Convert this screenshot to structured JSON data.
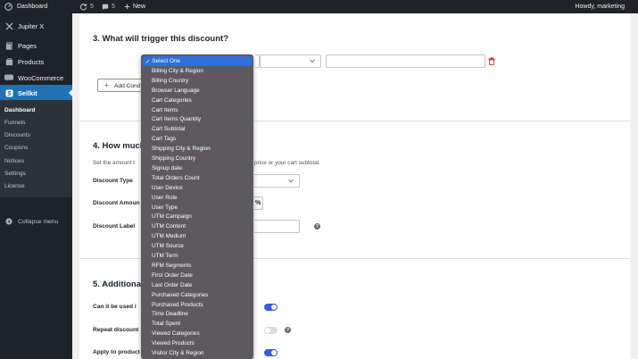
{
  "admin_bar": {
    "dashboard_label": "Dashboard",
    "updates_count": "5",
    "comments_count": "5",
    "new_label": "New",
    "howdy": "Howdy, marketing"
  },
  "sidebar": {
    "items": [
      {
        "label": "Jupiter X",
        "icon": "jupiterx-icon"
      },
      {
        "label": "Pages",
        "icon": "pages-icon"
      },
      {
        "label": "Products",
        "icon": "products-icon"
      },
      {
        "label": "WooCommerce",
        "icon": "woocommerce-icon"
      },
      {
        "label": "Sellkit",
        "icon": "sellkit-icon"
      }
    ],
    "submenu": [
      "Dashboard",
      "Funnels",
      "Discounts",
      "Coupons",
      "Notices",
      "Settings",
      "License"
    ],
    "collapse_label": "Collapse menu"
  },
  "main": {
    "section3_title": "3. What will trigger this discount?",
    "add_condition_label": "Add Cond",
    "section4_title": "4. How much",
    "section4_desc_left": "Set the amount t",
    "section4_desc_right": "price or your cart subtotal.",
    "discount_type_label": "Discount Type",
    "discount_amount_label": "Discount Amoun",
    "discount_amount_unit": "%",
    "discount_label_label": "Discount Label",
    "section5_title": "5. Additional",
    "can_be_used_label": "Can it be used i",
    "repeat_discount_label": "Repeat discount",
    "apply_to_products_label": "Apply to product"
  },
  "toggles": {
    "can_be_used_on": true,
    "repeat_discount_on": false,
    "apply_to_products_on": true
  },
  "dropdown": {
    "selected": "Select One",
    "options": [
      "Select One",
      "Billing City & Region",
      "Billing Country",
      "Browser Language",
      "Cart Categories",
      "Cart Items",
      "Cart Items Quantity",
      "Cart Subtotal",
      "Cart Tags",
      "Shipping City & Region",
      "Shipping Country",
      "Signup date",
      "Total Orders Count",
      "User Device",
      "User Role",
      "User Type",
      "UTM Campaign",
      "UTM Content",
      "UTM Medium",
      "UTM Source",
      "UTM Term",
      "RFM Segments",
      "First Order Date",
      "Last Order Date",
      "Purchased Categories",
      "Purchased Products",
      "Time Deadline",
      "Total Spent",
      "Viewed Categories",
      "Viewed Products",
      "Visitor City & Region"
    ]
  },
  "colors": {
    "accent": "#2271b1",
    "toggle_on": "#3858e9",
    "toggle_off": "#dcdcde",
    "delete_red": "#d63638",
    "dropdown_bg": "#5d5a5f",
    "dropdown_selected": "#2e6fd9"
  }
}
